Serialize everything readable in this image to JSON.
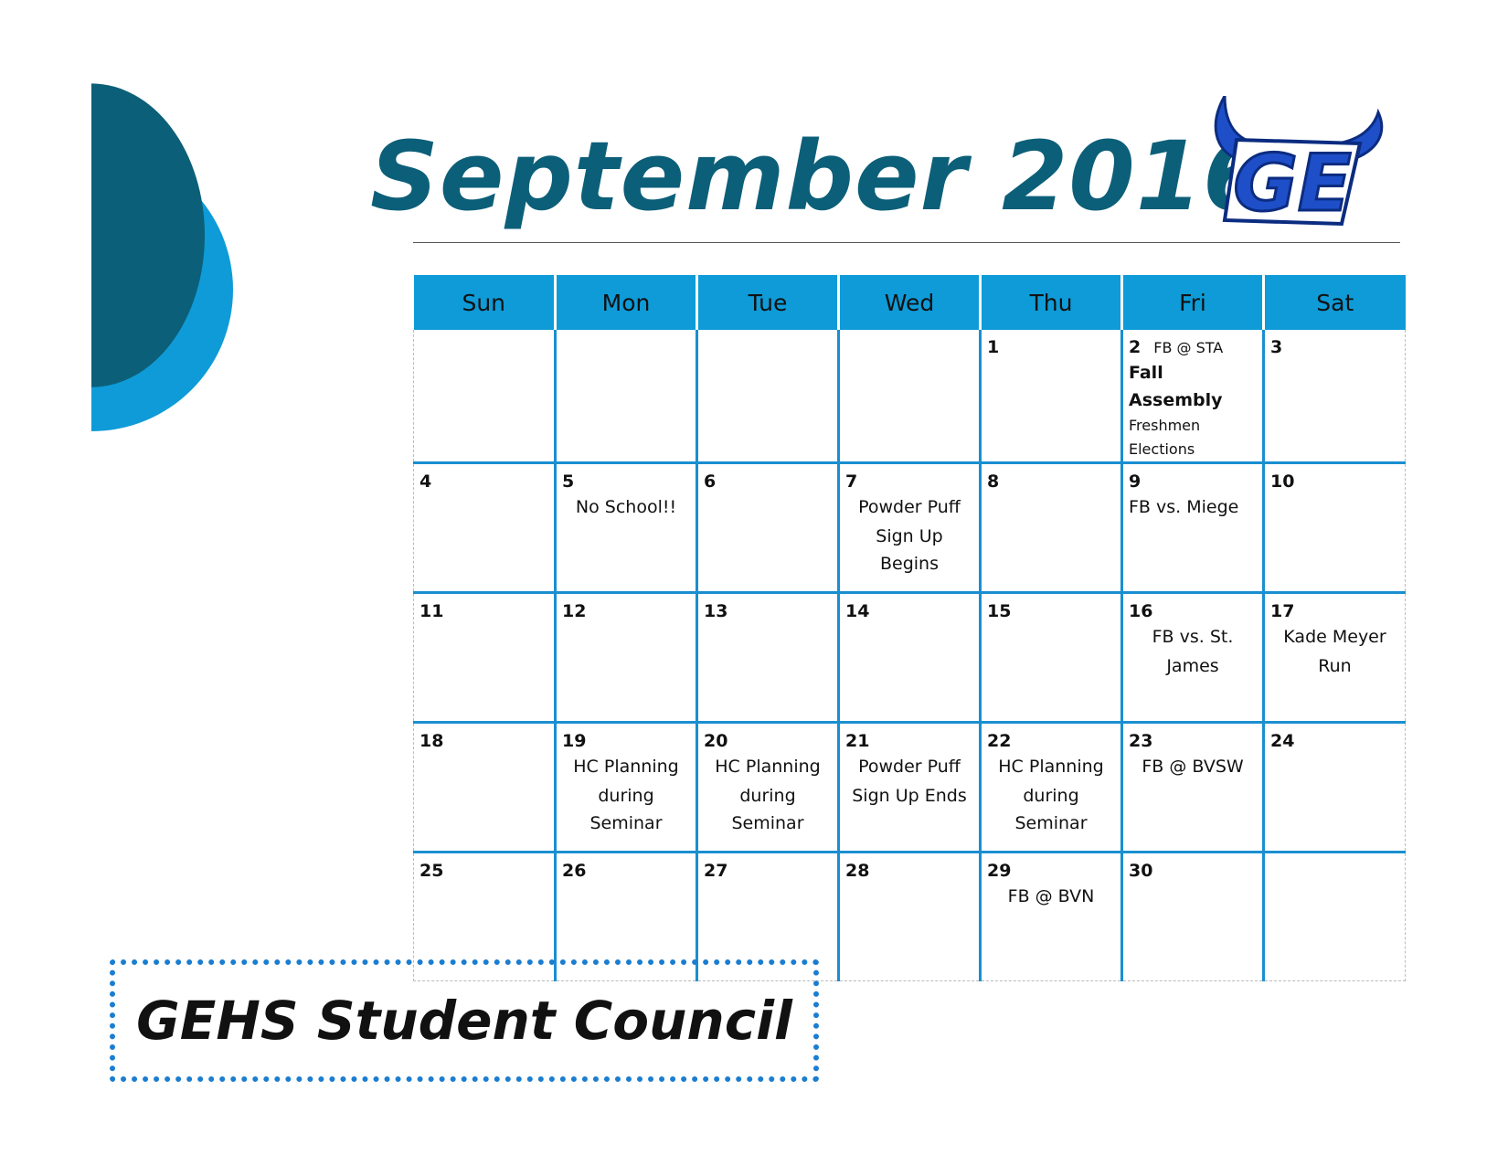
{
  "title": "September 2016",
  "logo_text": "GE",
  "colors": {
    "accent": "#0e9bd8",
    "dark_teal": "#0c5f78",
    "grid": "#1a8fd0",
    "logo_blue": "#1e4fc8"
  },
  "weekdays": [
    "Sun",
    "Mon",
    "Tue",
    "Wed",
    "Thu",
    "Fri",
    "Sat"
  ],
  "weeks": [
    [
      {
        "day": "",
        "events": []
      },
      {
        "day": "",
        "events": []
      },
      {
        "day": "",
        "events": []
      },
      {
        "day": "",
        "events": []
      },
      {
        "day": "1",
        "events": []
      },
      {
        "day": "2",
        "inline_event": "FB @ STA",
        "events": [
          "Fall Assembly"
        ],
        "small_events": [
          "Freshmen",
          "Elections"
        ]
      },
      {
        "day": "3",
        "events": []
      }
    ],
    [
      {
        "day": "4",
        "events": []
      },
      {
        "day": "5",
        "events": [
          "No School!!"
        ]
      },
      {
        "day": "6",
        "events": []
      },
      {
        "day": "7",
        "events": [
          "Powder Puff",
          "Sign Up Begins"
        ]
      },
      {
        "day": "8",
        "events": []
      },
      {
        "day": "9",
        "events": [
          "FB vs. Miege"
        ]
      },
      {
        "day": "10",
        "events": []
      }
    ],
    [
      {
        "day": "11",
        "events": []
      },
      {
        "day": "12",
        "events": []
      },
      {
        "day": "13",
        "events": []
      },
      {
        "day": "14",
        "events": []
      },
      {
        "day": "15",
        "events": []
      },
      {
        "day": "16",
        "events": [
          "FB vs. St.",
          "James"
        ]
      },
      {
        "day": "17",
        "events": [
          "Kade Meyer",
          "Run"
        ]
      }
    ],
    [
      {
        "day": "18",
        "events": []
      },
      {
        "day": "19",
        "events": [
          "HC Planning",
          "during Seminar"
        ]
      },
      {
        "day": "20",
        "events": [
          "HC Planning",
          "during Seminar"
        ]
      },
      {
        "day": "21",
        "events": [
          "Powder Puff",
          "Sign Up Ends"
        ]
      },
      {
        "day": "22",
        "events": [
          "HC Planning",
          "during Seminar"
        ]
      },
      {
        "day": "23",
        "events": [
          "FB @ BVSW"
        ]
      },
      {
        "day": "24",
        "events": []
      }
    ],
    [
      {
        "day": "25",
        "events": []
      },
      {
        "day": "26",
        "events": []
      },
      {
        "day": "27",
        "events": []
      },
      {
        "day": "28",
        "events": []
      },
      {
        "day": "29",
        "events": [
          "FB @ BVN"
        ]
      },
      {
        "day": "30",
        "events": []
      },
      {
        "day": "",
        "events": []
      }
    ]
  ],
  "footer": "GEHS Student Council"
}
